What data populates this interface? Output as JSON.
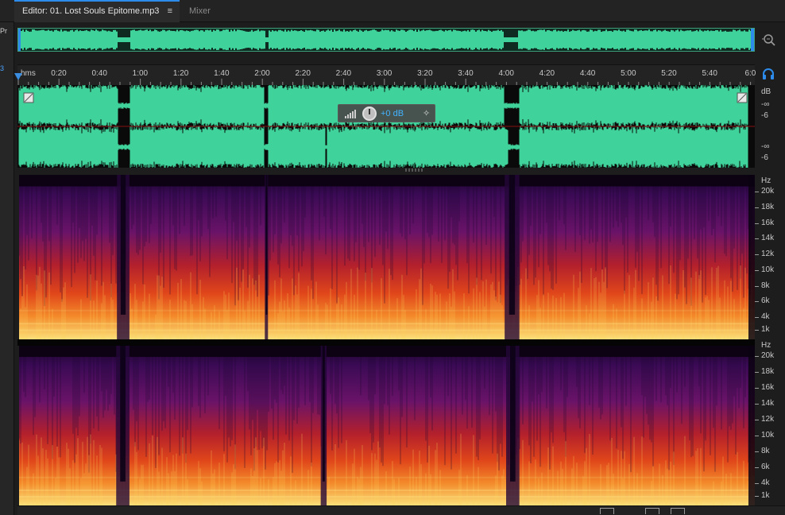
{
  "tabs": {
    "editor_label": "Editor: 01. Lost Souls Epitome.mp3",
    "editor_menu_glyph": "≡",
    "mixer_label": "Mixer"
  },
  "left_panel": {
    "edge_text_1": "Pr",
    "edge_text_2": "3"
  },
  "ruler": {
    "unit_label": "hms",
    "ticks": [
      "0:20",
      "0:40",
      "1:00",
      "1:20",
      "1:40",
      "2:00",
      "2:20",
      "2:40",
      "3:00",
      "3:20",
      "3:40",
      "4:00",
      "4:20",
      "4:40",
      "5:00",
      "5:20",
      "5:40",
      "6:0"
    ]
  },
  "hud": {
    "value": "+0 dB",
    "pin_glyph": "✎"
  },
  "amplitude_scale": {
    "channel_1": {
      "unit": "dB",
      "labels": [
        "-∞",
        "-6"
      ]
    },
    "channel_2": {
      "labels": [
        "-∞",
        "-6"
      ]
    }
  },
  "frequency_scale": {
    "unit": "Hz",
    "labels": [
      "20k",
      "18k",
      "16k",
      "14k",
      "12k",
      "10k",
      "8k",
      "6k",
      "4k",
      "1k"
    ]
  },
  "icons": {
    "zoom": "zoom-icon",
    "headphones": "headphones-icon",
    "playhead": "playhead-marker"
  },
  "colors": {
    "waveform": "#3fd39b",
    "accent": "#2d8ceb",
    "hud_value": "#43b2ff"
  }
}
